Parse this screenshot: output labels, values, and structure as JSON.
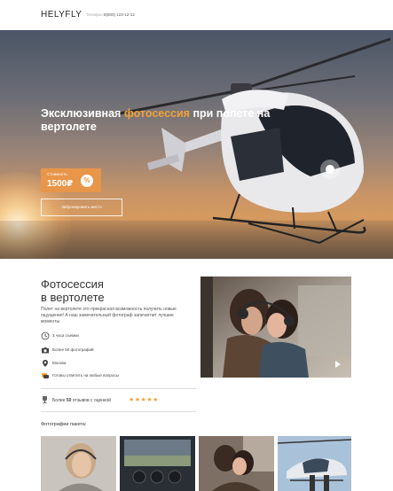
{
  "header": {
    "logo": "HELYFLY",
    "phone_label": "Телефон:",
    "phone_number": "8(800) 123-12-12"
  },
  "hero": {
    "title_part1": "Эксклюзивная ",
    "title_accent": "фотосессия",
    "title_part2": " при полете на вертолете",
    "price_label": "Стоимость:",
    "price_value": "1500₽",
    "discount_symbol": "%",
    "book_button": "Забронировать место",
    "accent_color": "#f0a23c",
    "price_box_color": "#e8964a"
  },
  "photosession": {
    "title_line1": "Фотосессия",
    "title_line2": "в вертолете",
    "description": "Полет на вертолете это прекрасная возможность получить новые ощущения! А наш замечательный фотограф запечатлит лучшие моменты",
    "features": [
      {
        "icon": "clock-icon",
        "text": "3 часа съемки"
      },
      {
        "icon": "camera-icon",
        "text": "Более 50 фотографий"
      },
      {
        "icon": "location-pin-icon",
        "text": "Москва"
      },
      {
        "icon": "chat-icon",
        "text": "Готовы ответить на любые вопросы"
      }
    ],
    "reviews_prefix": "Более ",
    "reviews_count": "50",
    "reviews_suffix": " отзывов с оценкой",
    "stars": "★★★★★",
    "rating": 5,
    "packages_label": "Фотографии пакета:"
  }
}
